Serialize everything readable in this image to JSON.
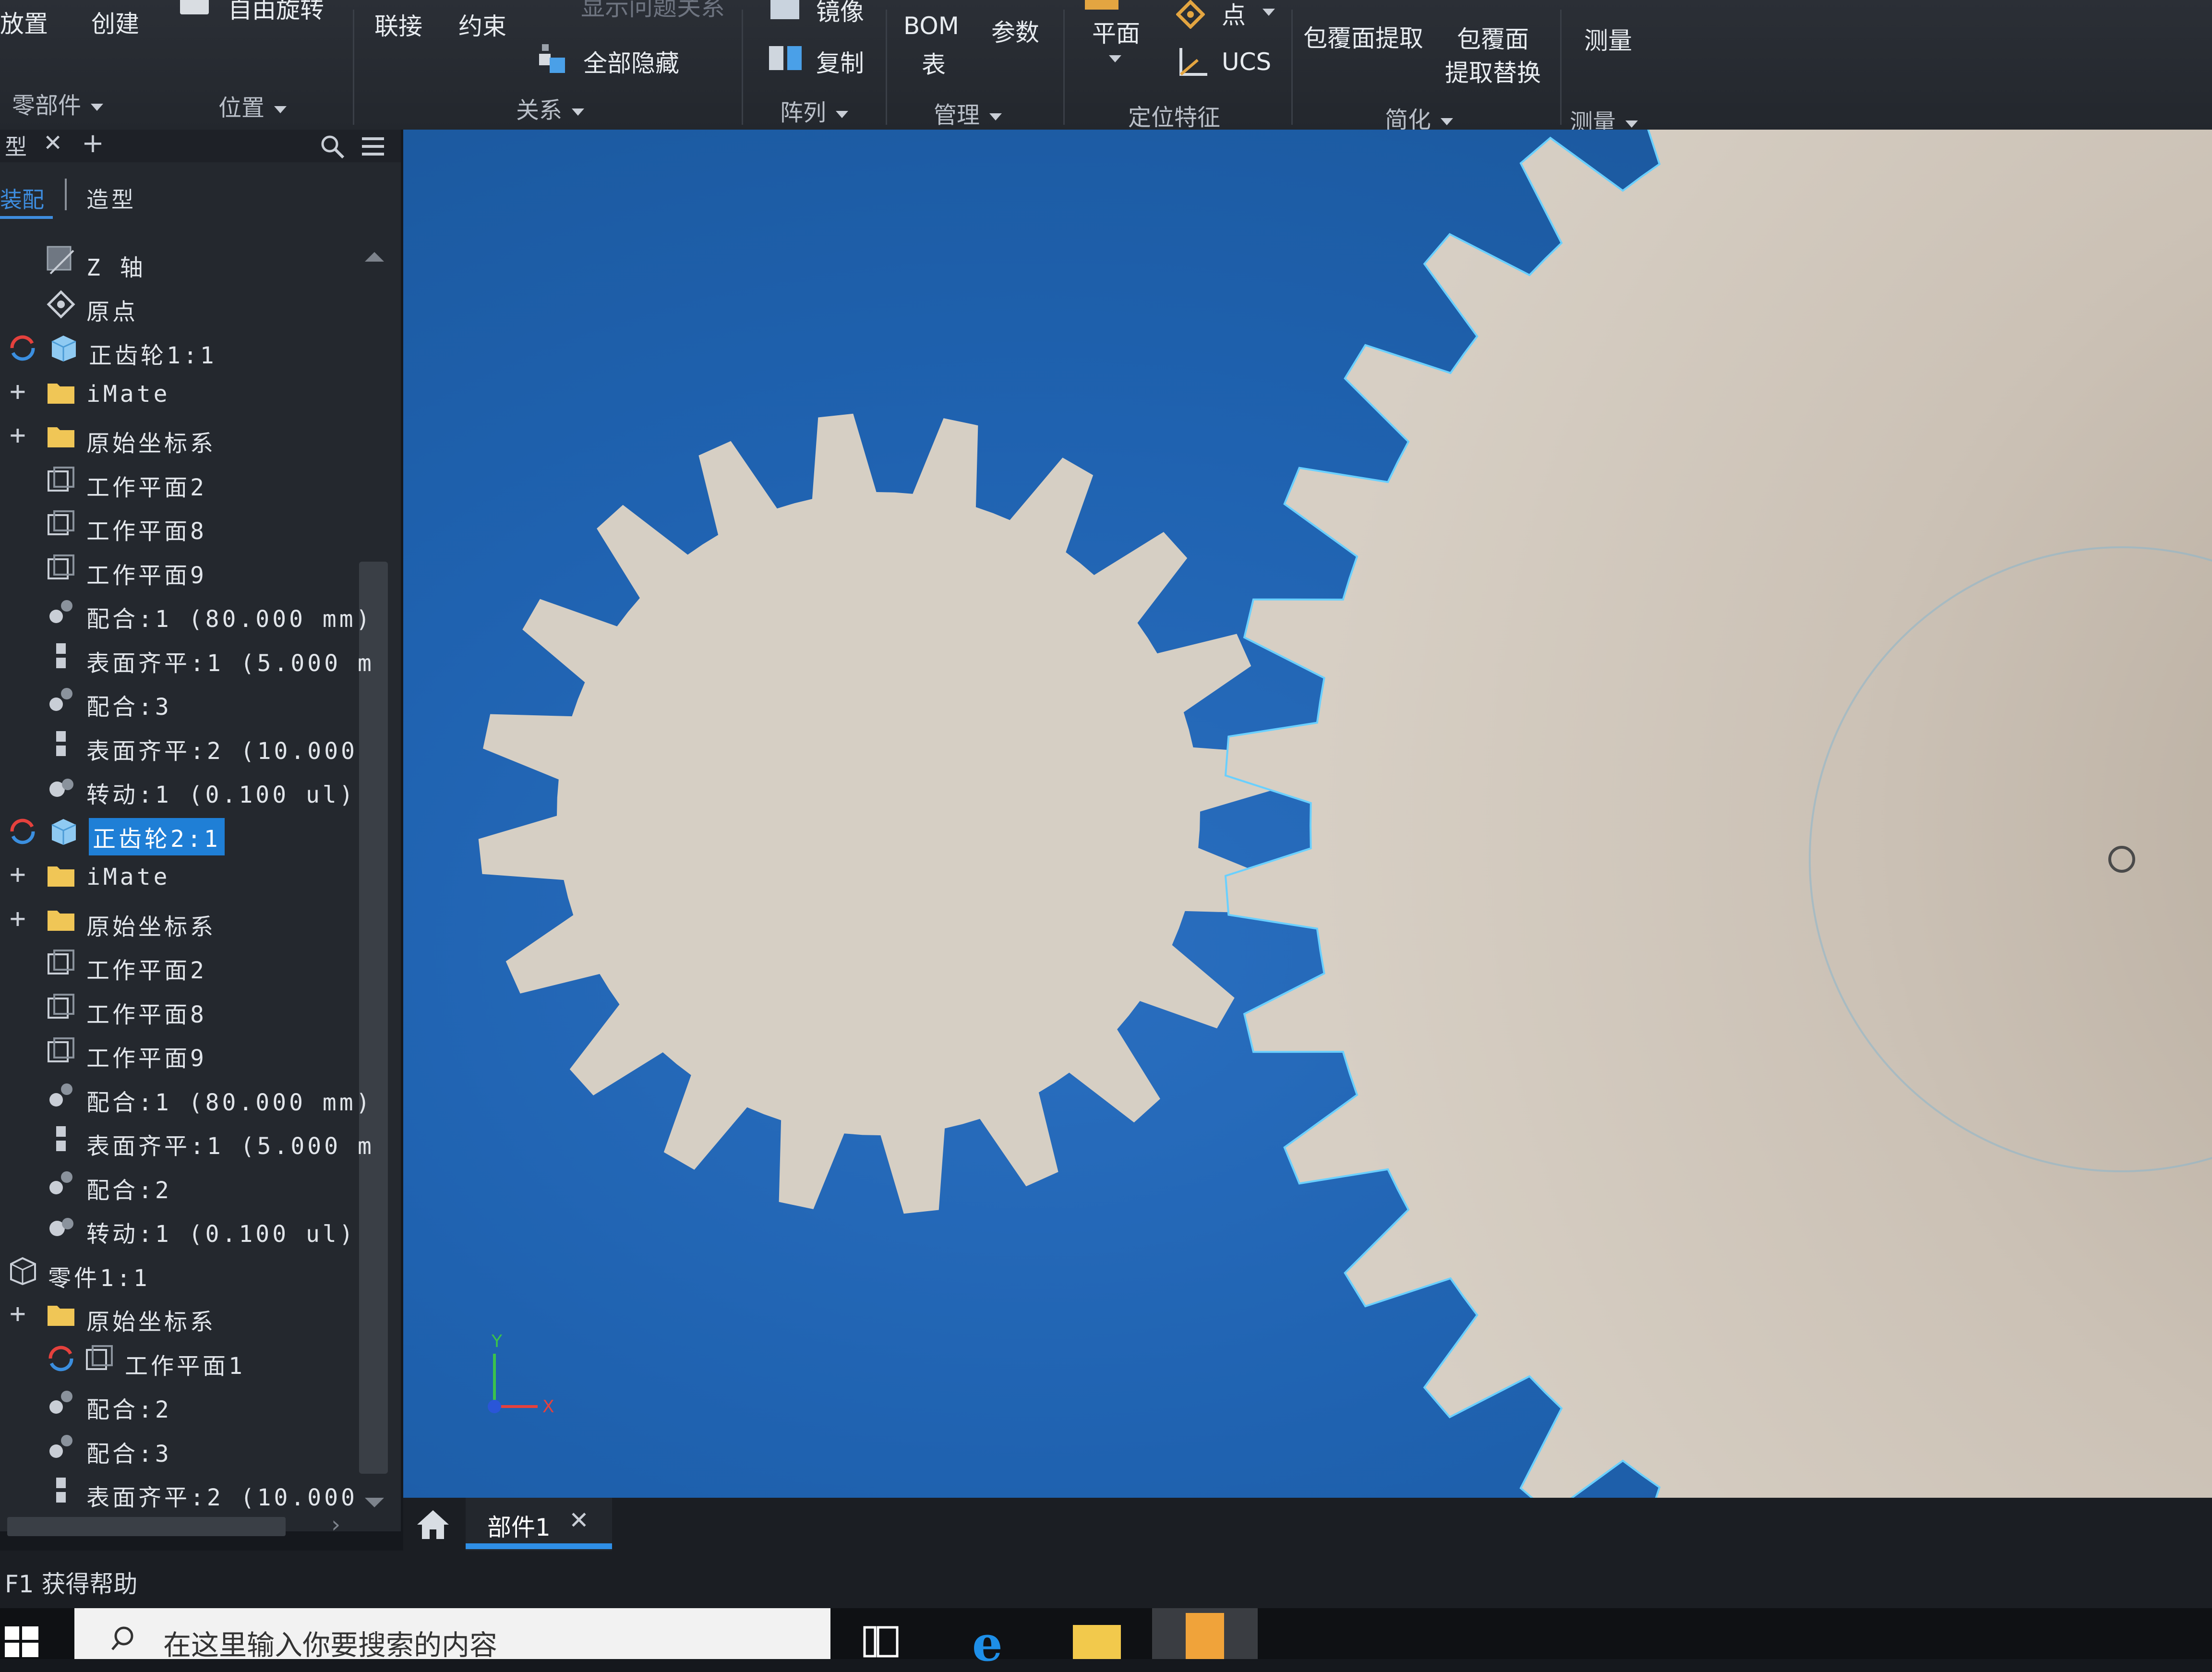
{
  "ribbon": {
    "row1": {
      "place": "放置",
      "create": "创建",
      "free_rotate": "自由旋转",
      "joint": "联接",
      "constrain": "约束",
      "show_relations": "显示问题关系",
      "mirror": "镜像",
      "bom_line1": "BOM",
      "bom_line2": "表",
      "params": "参数",
      "plane": "平面",
      "point": "点",
      "shrinkwrap": "包覆面提取",
      "shrinkwrap2_line1": "包覆面",
      "shrinkwrap2_line2": "提取替换",
      "measure": "测量"
    },
    "row2": {
      "hide_all": "全部隐藏",
      "copy": "复制",
      "ucs": "UCS"
    },
    "groups": {
      "component": "零部件",
      "position": "位置",
      "relations": "关系",
      "pattern": "阵列",
      "manage": "管理",
      "work_features": "定位特征",
      "simplify": "简化",
      "measure": "测量"
    }
  },
  "browser": {
    "tab_close": "✕",
    "tab_add": "+",
    "tabs": {
      "assembly": "装配",
      "modeling": "造型"
    },
    "tree": [
      {
        "label": "Z 轴",
        "icon": "axis-icon",
        "indent": 1,
        "expander": ""
      },
      {
        "label": "原点",
        "icon": "origin-point-icon",
        "indent": 1,
        "expander": ""
      },
      {
        "label": "正齿轮1:1",
        "icon": "part-icon",
        "indent": 0,
        "expander": "",
        "status": "update-icon"
      },
      {
        "label": "iMate",
        "icon": "folder-icon",
        "indent": 1,
        "expander": "+"
      },
      {
        "label": "原始坐标系",
        "icon": "folder-icon",
        "indent": 1,
        "expander": "+"
      },
      {
        "label": "工作平面2",
        "icon": "work-plane-icon",
        "indent": 1,
        "expander": ""
      },
      {
        "label": "工作平面8",
        "icon": "work-plane-icon",
        "indent": 1,
        "expander": ""
      },
      {
        "label": "工作平面9",
        "icon": "work-plane-icon",
        "indent": 1,
        "expander": ""
      },
      {
        "label": "配合:1 (80.000 mm)",
        "icon": "mate-constraint-icon",
        "indent": 1,
        "expander": ""
      },
      {
        "label": "表面齐平:1 (5.000 m",
        "icon": "flush-constraint-icon",
        "indent": 1,
        "expander": ""
      },
      {
        "label": "配合:3",
        "icon": "mate-constraint-icon",
        "indent": 1,
        "expander": ""
      },
      {
        "label": "表面齐平:2 (10.000",
        "icon": "flush-constraint-icon",
        "indent": 1,
        "expander": ""
      },
      {
        "label": "转动:1 (0.100 ul)",
        "icon": "rotation-constraint-icon",
        "indent": 1,
        "expander": ""
      },
      {
        "label": "正齿轮2:1",
        "icon": "part-icon",
        "indent": 0,
        "expander": "",
        "status": "update-icon",
        "selected": true
      },
      {
        "label": "iMate",
        "icon": "folder-icon",
        "indent": 1,
        "expander": "+"
      },
      {
        "label": "原始坐标系",
        "icon": "folder-icon",
        "indent": 1,
        "expander": "+"
      },
      {
        "label": "工作平面2",
        "icon": "work-plane-icon",
        "indent": 1,
        "expander": ""
      },
      {
        "label": "工作平面8",
        "icon": "work-plane-icon",
        "indent": 1,
        "expander": ""
      },
      {
        "label": "工作平面9",
        "icon": "work-plane-icon",
        "indent": 1,
        "expander": ""
      },
      {
        "label": "配合:1 (80.000 mm)",
        "icon": "mate-constraint-icon",
        "indent": 1,
        "expander": ""
      },
      {
        "label": "表面齐平:1 (5.000 m",
        "icon": "flush-constraint-icon",
        "indent": 1,
        "expander": ""
      },
      {
        "label": "配合:2",
        "icon": "mate-constraint-icon",
        "indent": 1,
        "expander": ""
      },
      {
        "label": "转动:1 (0.100 ul)",
        "icon": "rotation-constraint-icon",
        "indent": 1,
        "expander": ""
      },
      {
        "label": "零件1:1",
        "icon": "part-outline-icon",
        "indent": 0,
        "expander": ""
      },
      {
        "label": "原始坐标系",
        "icon": "folder-icon",
        "indent": 1,
        "expander": "+"
      },
      {
        "label": "工作平面1",
        "icon": "work-plane-icon",
        "indent": 1,
        "expander": "",
        "status": "update-icon"
      },
      {
        "label": "配合:2",
        "icon": "mate-constraint-icon",
        "indent": 1,
        "expander": ""
      },
      {
        "label": "配合:3",
        "icon": "mate-constraint-icon",
        "indent": 1,
        "expander": ""
      },
      {
        "label": "表面齐平:2 (10.000",
        "icon": "flush-constraint-icon",
        "indent": 1,
        "expander": ""
      }
    ]
  },
  "viewport": {
    "triad_y": "Y",
    "triad_x": "X",
    "small_gear_teeth": 20,
    "large_gear_teeth": 40
  },
  "doc_tabs": [
    {
      "label": "部件1",
      "close": "✕",
      "active": true
    }
  ],
  "status_bar": {
    "help": "F1 获得帮助"
  },
  "taskbar": {
    "search_placeholder": "在这里输入你要搜索的内容"
  },
  "colors": {
    "viewport_blue": "#1f62b0",
    "gear_fill": "#d6cfc4",
    "selection_blue": "#1f7fd6",
    "edge_highlight": "#6ad0ff"
  }
}
